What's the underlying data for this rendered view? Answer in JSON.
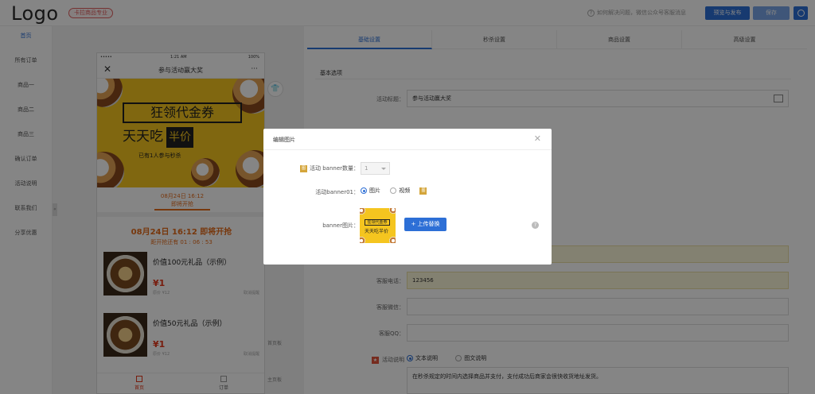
{
  "topbar": {
    "logo": "Logo",
    "version_badge": "卡拉商品专业",
    "help_text": "如何解决问题，微信公众号客服消息",
    "preview_button": "预览与发布",
    "save_button": "保存"
  },
  "leftnav": {
    "items": [
      "首页",
      "所有订单",
      "商品一",
      "商品二",
      "商品三",
      "确认订单",
      "活动说明",
      "联系我们",
      "分享优惠"
    ]
  },
  "phone": {
    "status": {
      "signal": "•••••",
      "time": "1:21 AM",
      "battery": "100%"
    },
    "nav_title": "参与活动赢大奖",
    "banner": {
      "headline1": "狂领代金券",
      "headline2": "天天吃",
      "headline2_tag": "半价",
      "sub": "已有1人参与秒杀"
    },
    "countdown_tab": [
      "08月24日 16:12",
      "即将开抢"
    ],
    "start_line": "08月24日 16:12 即将开抢",
    "start_count": "距开抢还有 01 : 06 : 53",
    "products": [
      {
        "name": "价值100元礼品（示例）",
        "price": "¥1",
        "orig": "原价 ¥12",
        "remind": "取消提醒"
      },
      {
        "name": "价值50元礼品（示例）",
        "price": "¥1",
        "orig": "原价 ¥12",
        "remind": "取消提醒"
      }
    ],
    "tabbar": [
      "首页",
      "订单"
    ]
  },
  "preview_side": {
    "labels": [
      "首页板",
      "主页板"
    ]
  },
  "settings": {
    "tabs": [
      "基础设置",
      "秒杀设置",
      "商品设置",
      "高级设置"
    ],
    "section_title": "基本选项",
    "activity_title_label": "活动标题：",
    "activity_title_value": "参与活动赢大奖",
    "phone_label": "客服电话：",
    "phone_value": "123456",
    "wechat_label": "客服微信：",
    "qq_label": "客服QQ：",
    "desc_label": "活动说明",
    "desc_options": [
      "文本说明",
      "图文说明"
    ],
    "desc_text": "在秒杀规定的时间内选择商品并支付，支付成功后商家会很快收货地址发货。"
  },
  "modal": {
    "title": "编辑图片",
    "count_label": "活动 banner数量：",
    "count_value": "1",
    "banner01_label": "活动banner01：",
    "type_options": [
      "图片",
      "视频"
    ],
    "image_label": "banner图片：",
    "upload_button": "+ 上传替换",
    "thumb_text1": "狂领代金券",
    "thumb_text2": "天天吃半价"
  }
}
